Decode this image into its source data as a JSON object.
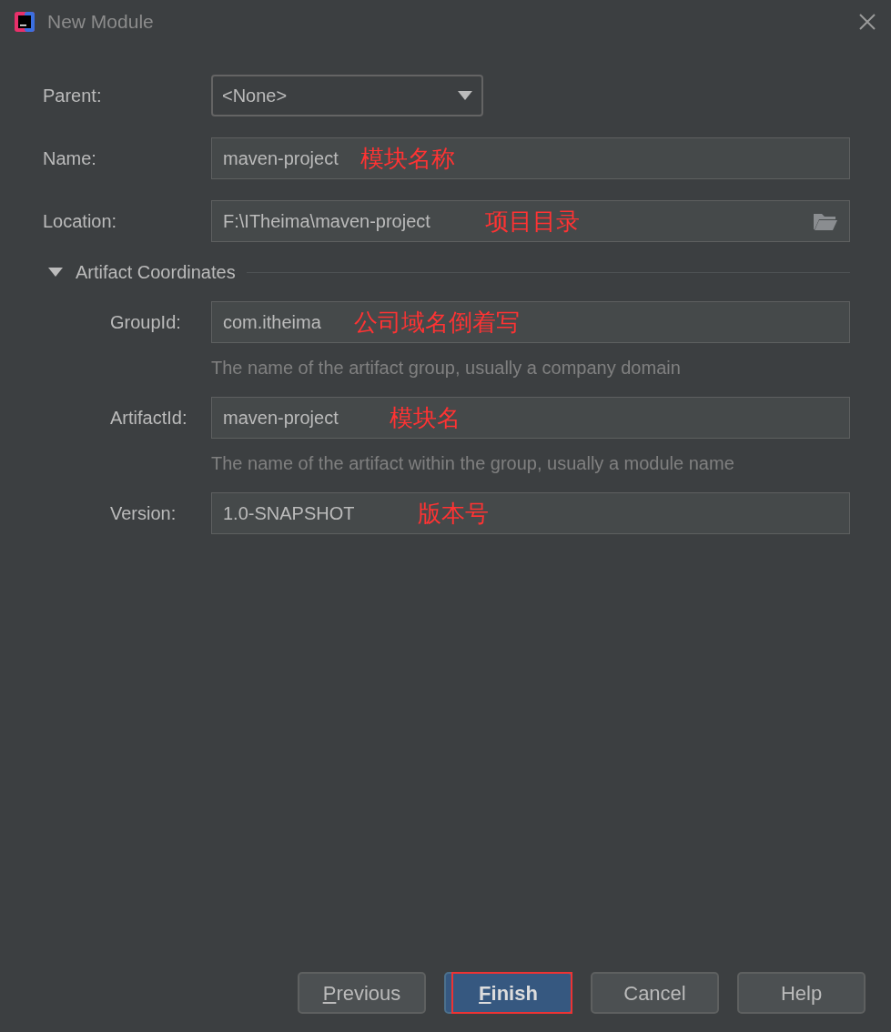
{
  "window": {
    "title": "New Module"
  },
  "parent": {
    "label": "Parent:",
    "value": "<None>"
  },
  "fields": [
    {
      "label": "Name:",
      "value": "maven-project",
      "note": "模块名称",
      "browse": false
    },
    {
      "label": "Location:",
      "value": "F:\\ITheima\\maven-project",
      "note": "项目目录",
      "browse": true
    }
  ],
  "artifact_section": {
    "title": "Artifact Coordinates",
    "expanded": true,
    "fields": [
      {
        "label": "GroupId:",
        "value": "com.itheima",
        "note": "公司域名倒着写",
        "hint": "The name of the artifact group, usually a company domain"
      },
      {
        "label": "ArtifactId:",
        "value": "maven-project",
        "note": "模块名",
        "hint": "The name of the artifact within the group, usually a module name"
      },
      {
        "label": "Version:",
        "value": "1.0-SNAPSHOT",
        "note": "版本号"
      }
    ]
  },
  "buttons": [
    {
      "label": "Previous",
      "default": false,
      "mnemonic": true,
      "highlighted": false
    },
    {
      "label": "Finish",
      "default": true,
      "mnemonic": true,
      "highlighted": true
    },
    {
      "label": "Cancel",
      "default": false,
      "mnemonic": false,
      "highlighted": false
    },
    {
      "label": "Help",
      "default": false,
      "mnemonic": false,
      "highlighted": false
    }
  ]
}
